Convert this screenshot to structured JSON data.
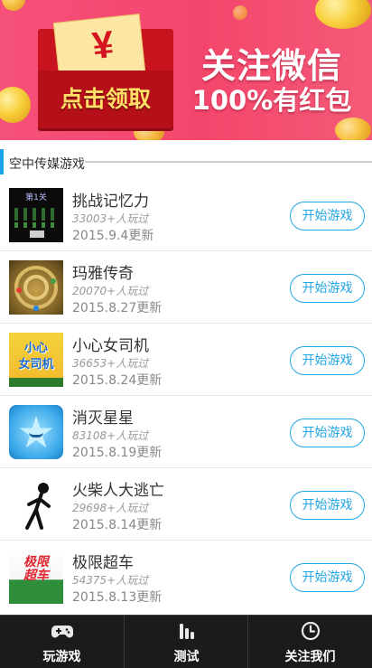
{
  "banner": {
    "envelope_symbol": "¥",
    "envelope_label": "点击领取",
    "title": "关注微信",
    "subtitle": "100%有红包"
  },
  "section": {
    "title": "空中传媒游戏"
  },
  "games": [
    {
      "name": "挑战记忆力",
      "players": "33003+人玩过",
      "updated": "2015.9.4更新",
      "button": "开始游戏",
      "thumb_text": "第1关"
    },
    {
      "name": "玛雅传奇",
      "players": "20070+人玩过",
      "updated": "2015.8.27更新",
      "button": "开始游戏"
    },
    {
      "name": "小心女司机",
      "players": "36653+人玩过",
      "updated": "2015.8.24更新",
      "button": "开始游戏",
      "thumb_text_1": "小心",
      "thumb_text_2": "女司机"
    },
    {
      "name": "消灭星星",
      "players": "83108+人玩过",
      "updated": "2015.8.19更新",
      "button": "开始游戏"
    },
    {
      "name": "火柴人大逃亡",
      "players": "29698+人玩过",
      "updated": "2015.8.14更新",
      "button": "开始游戏"
    },
    {
      "name": "极限超车",
      "players": "54375+人玩过",
      "updated": "2015.8.13更新",
      "button": "开始游戏",
      "thumb_text_1": "极限",
      "thumb_text_2": "超车"
    }
  ],
  "nav": {
    "items": [
      {
        "label": "玩游戏",
        "icon": "gamepad-icon"
      },
      {
        "label": "测试",
        "icon": "bar-chart-icon"
      },
      {
        "label": "关注我们",
        "icon": "clock-icon"
      }
    ]
  },
  "colors": {
    "accent": "#20a6e6",
    "banner_bg": "#f4466c",
    "nav_bg": "#1b1b1b"
  }
}
